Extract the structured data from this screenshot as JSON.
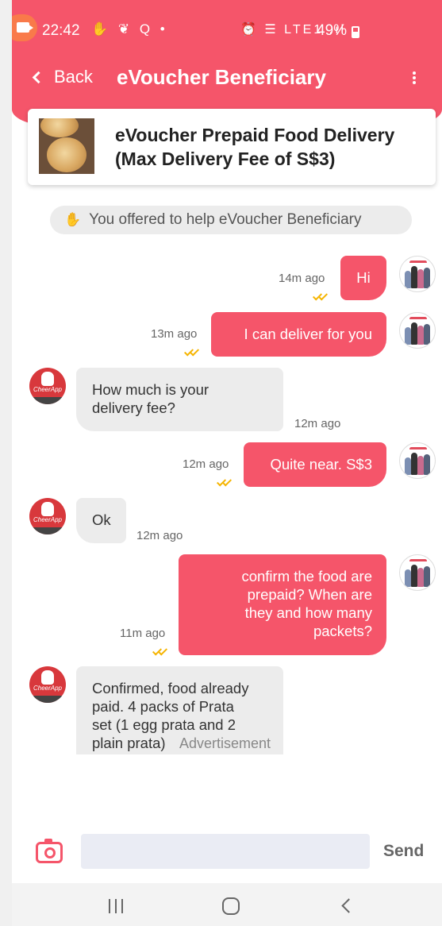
{
  "status_bar": {
    "time": "22:42",
    "left_icons": "✋ ❦ Q •",
    "right_icons": "⏰ ☰ LTE1 .ıl",
    "battery": "49%"
  },
  "header": {
    "back_label": "Back",
    "title": "eVoucher Beneficiary"
  },
  "listing": {
    "title_line1": "eVoucher Prepaid Food Delivery",
    "title_line2": "(Max Delivery Fee of S$3)"
  },
  "system_message": "You offered to help eVoucher Beneficiary",
  "messages": [
    {
      "direction": "out",
      "text": "Hi",
      "time": "14m ago"
    },
    {
      "direction": "out",
      "text": "I can deliver for you",
      "time": "13m ago"
    },
    {
      "direction": "in",
      "line1": "How much is your",
      "line2": "delivery fee?",
      "time": "12m ago"
    },
    {
      "direction": "out",
      "text": "Quite near. S$3",
      "time": "12m ago"
    },
    {
      "direction": "in",
      "text": "Ok",
      "time": "12m ago"
    },
    {
      "direction": "out",
      "line1": "confirm the food are",
      "line2": "prepaid? When are",
      "line3": "they and how many",
      "line4": "packets?",
      "time": "11m ago"
    },
    {
      "direction": "in",
      "line1": "Confirmed, food already",
      "line2": "paid. 4 packs of Prata",
      "line3": "set (1 egg prata and 2",
      "line4": "plain prata)"
    }
  ],
  "ad_label": "Advertisement",
  "avatar_brand": "CheerApp",
  "composer": {
    "placeholder": "",
    "send_label": "Send"
  },
  "colors": {
    "accent": "#f5556a",
    "incoming_bubble": "#ececec",
    "read_ticks": "#f5b400"
  }
}
